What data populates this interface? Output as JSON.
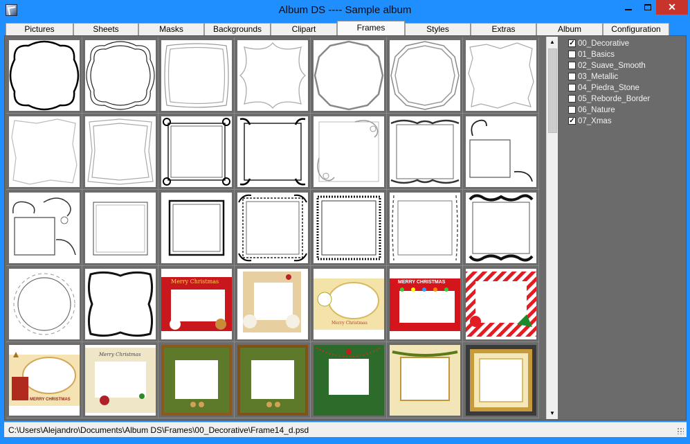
{
  "window": {
    "title": "Album DS   ----   Sample album",
    "minimize_icon": "minimize-icon",
    "maximize_icon": "maximize-icon",
    "close_label": "✕"
  },
  "tabs": [
    {
      "label": "Pictures",
      "active": false
    },
    {
      "label": "Sheets",
      "active": false
    },
    {
      "label": "Masks",
      "active": false
    },
    {
      "label": "Backgrounds",
      "active": false
    },
    {
      "label": "Clipart",
      "active": false
    },
    {
      "label": "Frames",
      "active": true
    },
    {
      "label": "Styles",
      "active": false
    },
    {
      "label": "Extras",
      "active": false
    },
    {
      "label": "Album",
      "active": false
    },
    {
      "label": "Configuration",
      "active": false
    }
  ],
  "categories": [
    {
      "label": "00_Decorative",
      "checked": true
    },
    {
      "label": "01_Basics",
      "checked": false
    },
    {
      "label": "02_Suave_Smooth",
      "checked": false
    },
    {
      "label": "03_Metallic",
      "checked": false
    },
    {
      "label": "04_Piedra_Stone",
      "checked": false
    },
    {
      "label": "05_Reborde_Border",
      "checked": false
    },
    {
      "label": "06_Nature",
      "checked": false
    },
    {
      "label": "07_Xmas",
      "checked": true
    }
  ],
  "frames": {
    "row_1": [
      "scalloped-black-frame",
      "scalloped-double-frame",
      "soft-double-frame",
      "wavy-arch-frame",
      "gothic-arch-frame",
      "gothic-double-frame",
      "torn-paper-frame"
    ],
    "row_2": [
      "jagged-paper-frame",
      "jagged-double-frame",
      "ornate-corner-frame",
      "ornate-corner-frame-2",
      "swirl-corner-frame",
      "baroque-frame",
      "offset-swirl-frame"
    ],
    "row_3": [
      "floral-swirl-frame",
      "thin-square-frame",
      "bold-square-frame",
      "lace-square-frame",
      "chain-border-frame",
      "vine-border-frame",
      "scroll-border-frame"
    ],
    "row_4": [
      "floral-oval-frame",
      "vine-wreath-frame",
      "merry-christmas-frame",
      "snowman-frame",
      "snowman-oval-frame",
      "merry-christmas-lights-frame",
      "candy-stripe-frame"
    ],
    "row_5": [
      "xmas-oval-frame",
      "merry-christmas-oval-frame",
      "garland-frame",
      "garland-frame-2",
      "holly-frame",
      "garland-gold-frame",
      "gold-bead-frame"
    ]
  },
  "xmas_texts": {
    "merry_christmas_red": "Merry Christmas",
    "merry_christmas_lights": "MERRY CHRISTMAS",
    "merry_christmas_small": "Merry Christmas",
    "merry_christmas_script": "Merry Christmas",
    "merry_christmas_bottom": "MERRY CHRISTMAS"
  },
  "status": {
    "path": "C:\\Users\\Alejandro\\Documents\\Album DS\\Frames\\00_Decorative\\Frame14_d.psd"
  },
  "colors": {
    "title_bar": "#1f8fff",
    "panel_bg": "#6b6b6b",
    "close_button": "#c7342b"
  }
}
